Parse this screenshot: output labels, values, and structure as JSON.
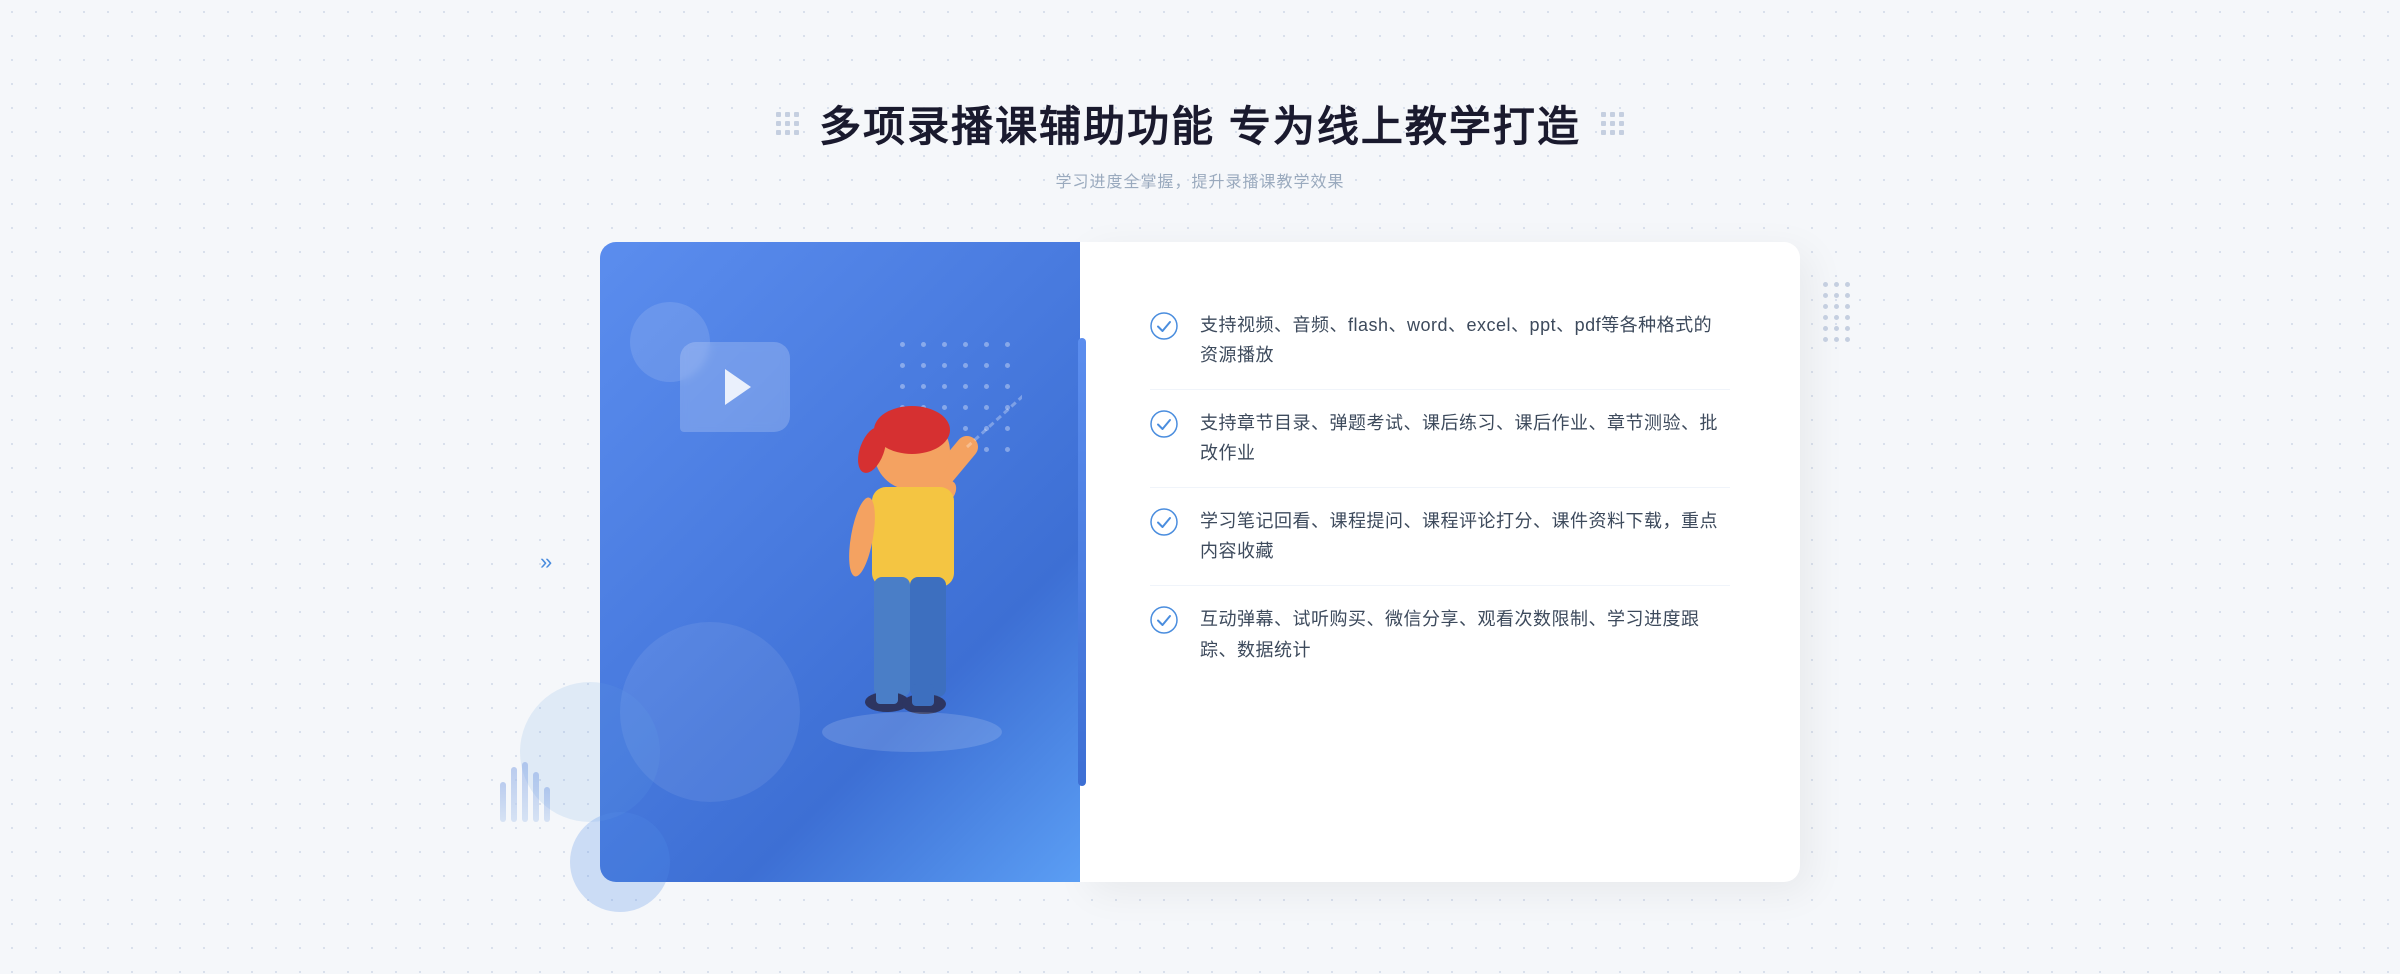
{
  "header": {
    "title": "多项录播课辅助功能 专为线上教学打造",
    "subtitle": "学习进度全掌握，提升录播课教学效果"
  },
  "decorative": {
    "left_chevron": "»",
    "dots_count": 6
  },
  "features": [
    {
      "id": 1,
      "text": "支持视频、音频、flash、word、excel、ppt、pdf等各种格式的资源播放"
    },
    {
      "id": 2,
      "text": "支持章节目录、弹题考试、课后练习、课后作业、章节测验、批改作业"
    },
    {
      "id": 3,
      "text": "学习笔记回看、课程提问、课程评论打分、课件资料下载，重点内容收藏"
    },
    {
      "id": 4,
      "text": "互动弹幕、试听购买、微信分享、观看次数限制、学习进度跟踪、数据统计"
    }
  ]
}
